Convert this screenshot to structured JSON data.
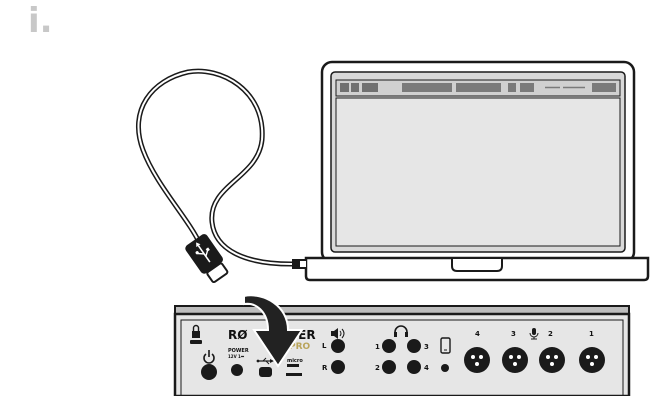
{
  "step_label": "i.",
  "interface": {
    "brand_left": "RØ",
    "brand_right": "TER",
    "model": "PRO",
    "power_label": "POWER",
    "power_sub": "12V 1⎓",
    "monitor_labels": [
      "L",
      "R"
    ],
    "headphone_left": [
      "1",
      "2"
    ],
    "headphone_right": [
      "3",
      "4"
    ],
    "xlr_labels": [
      "4",
      "3",
      "2",
      "1"
    ],
    "sd_label": "micro"
  },
  "colors": {
    "outline": "#1a1a1a",
    "panel": "#e6e6e6",
    "panel_dark": "#bdbdbd",
    "screen": "#e6e6e6",
    "arrow": "#222222",
    "step": "#c8c8c8",
    "accent_pro": "#b9a45a"
  },
  "icons": [
    "lock-icon",
    "power-icon",
    "usb-icon",
    "speaker-icon",
    "headphones-icon",
    "phone-icon",
    "microphone-icon",
    "usb-c-plug-icon",
    "arrow-icon",
    "laptop-icon",
    "cable-icon"
  ]
}
